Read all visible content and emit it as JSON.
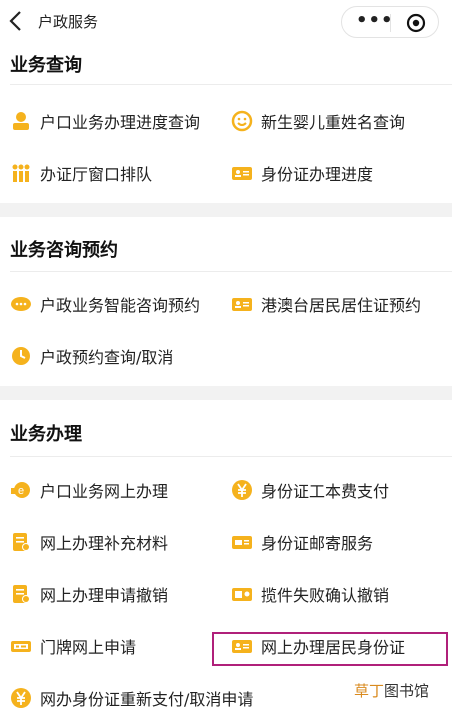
{
  "header": {
    "title": "户政服务",
    "menu_dots": "•••"
  },
  "sections": {
    "query": {
      "title": "业务查询",
      "items": [
        "户口业务办理进度查询",
        "新生婴儿重姓名查询",
        "办证厅窗口排队",
        "身份证办理进度"
      ]
    },
    "consult": {
      "title": "业务咨询预约",
      "items": [
        "户政业务智能咨询预约",
        "港澳台居民居住证预约",
        "户政预约查询/取消"
      ]
    },
    "handle": {
      "title": "业务办理",
      "items": [
        "户口业务网上办理",
        "身份证工本费支付",
        "网上办理补充材料",
        "身份证邮寄服务",
        "网上办理申请撤销",
        "揽件失败确认撤销",
        "门牌网上申请",
        "网上办理居民身份证",
        "网办身份证重新支付/取消申请"
      ]
    }
  },
  "watermark": {
    "part1": "草丁",
    "part2": "图书馆"
  },
  "colors": {
    "icon": "#f5b21d",
    "highlight": "#b0207a",
    "gap": "#f2f2f2"
  }
}
